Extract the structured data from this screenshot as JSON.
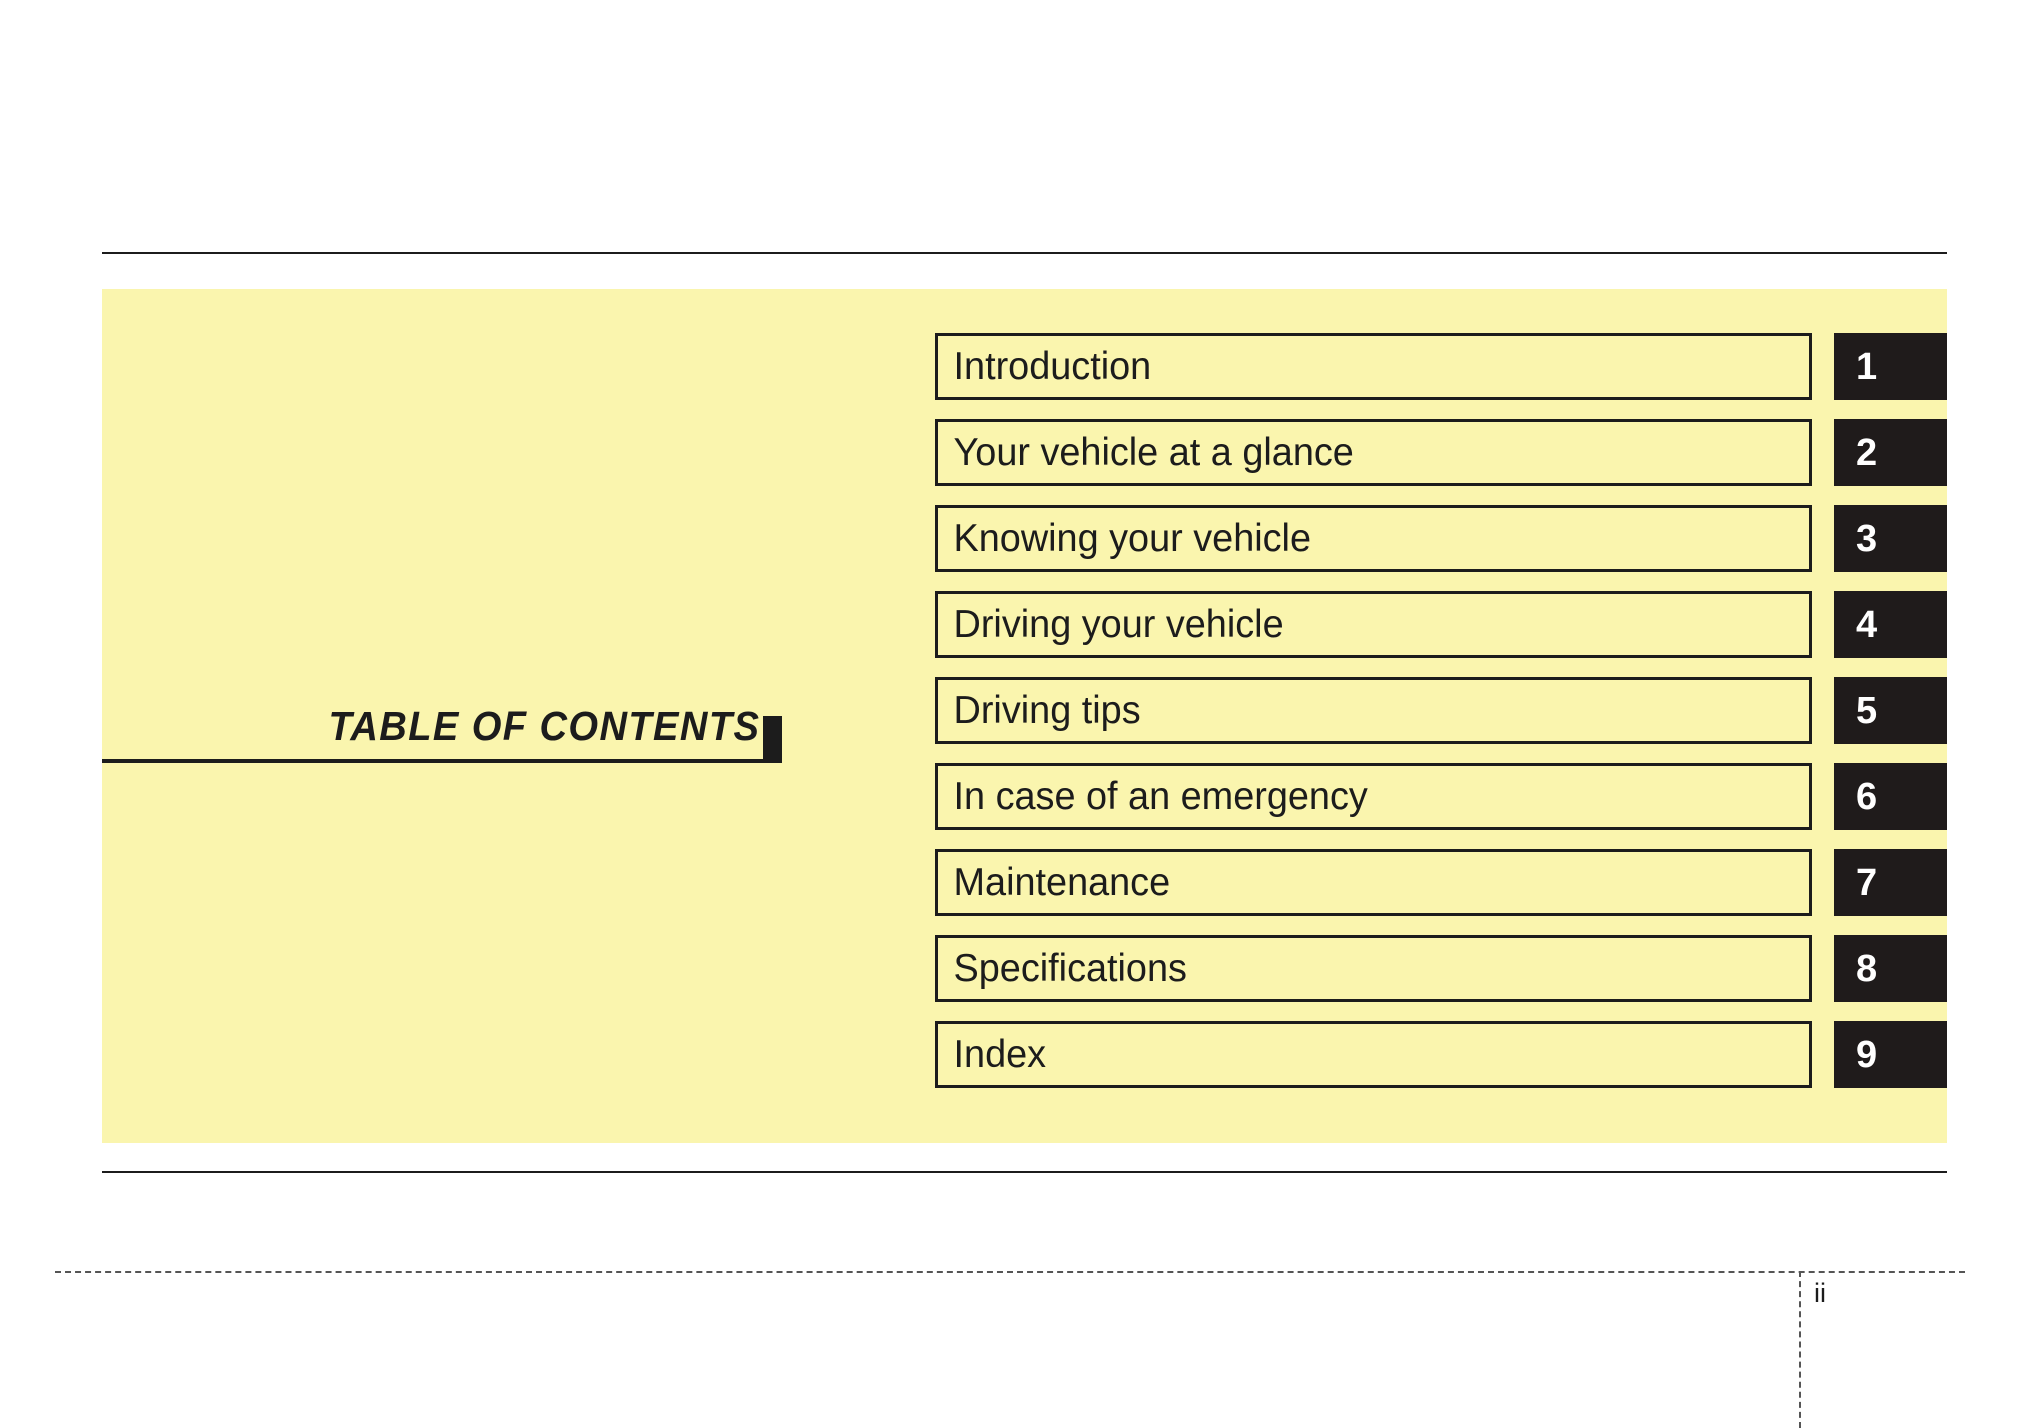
{
  "page": {
    "title": "TABLE OF CONTENTS",
    "page_number": "ii",
    "panel_color": "#faf5ae",
    "ink_color": "#1c1c1c",
    "tab_color": "#1f1b1b",
    "tab_number_color": "#ffffff"
  },
  "contents": {
    "items": [
      {
        "label": "Introduction",
        "number": "1"
      },
      {
        "label": "Your vehicle at a glance",
        "number": "2"
      },
      {
        "label": "Knowing your vehicle",
        "number": "3"
      },
      {
        "label": "Driving your vehicle",
        "number": "4"
      },
      {
        "label": "Driving tips",
        "number": "5"
      },
      {
        "label": "In case of an emergency",
        "number": "6"
      },
      {
        "label": "Maintenance",
        "number": "7"
      },
      {
        "label": "Specifications",
        "number": "8"
      },
      {
        "label": "Index",
        "number": "9"
      }
    ]
  }
}
